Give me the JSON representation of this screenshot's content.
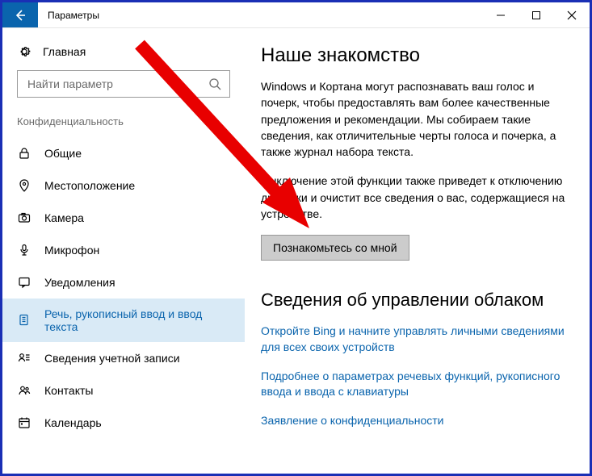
{
  "titlebar": {
    "title": "Параметры"
  },
  "sidebar": {
    "home_label": "Главная",
    "search_placeholder": "Найти параметр",
    "section_label": "Конфиденциальность",
    "items": [
      {
        "icon": "lock-icon",
        "label": "Общие"
      },
      {
        "icon": "location-icon",
        "label": "Местоположение"
      },
      {
        "icon": "camera-icon",
        "label": "Камера"
      },
      {
        "icon": "microphone-icon",
        "label": "Микрофон"
      },
      {
        "icon": "notifications-icon",
        "label": "Уведомления"
      },
      {
        "icon": "speech-icon",
        "label": "Речь, рукописный ввод и ввод текста"
      },
      {
        "icon": "account-info-icon",
        "label": "Сведения учетной записи"
      },
      {
        "icon": "contacts-icon",
        "label": "Контакты"
      },
      {
        "icon": "calendar-icon",
        "label": "Календарь"
      }
    ]
  },
  "main": {
    "heading1": "Наше знакомство",
    "para1": "Windows и Кортана могут распознавать ваш голос и почерк, чтобы предоставлять вам более качественные предложения и рекомендации. Мы собираем такие сведения, как отличительные черты голоса и почерка, а также журнал набора текста.",
    "para2": "Выключение этой функции также приведет к отключению диктовки и очистит все сведения о вас, содержащиеся на устройстве.",
    "button_label": "Познакомьтесь со мной",
    "heading2": "Сведения об управлении облаком",
    "link1": "Откройте Bing и начните управлять личными сведениями для всех своих устройств",
    "link2": "Подробнее о параметрах речевых функций, рукописного ввода и ввода с клавиатуры",
    "link3": "Заявление о конфиденциальности"
  }
}
